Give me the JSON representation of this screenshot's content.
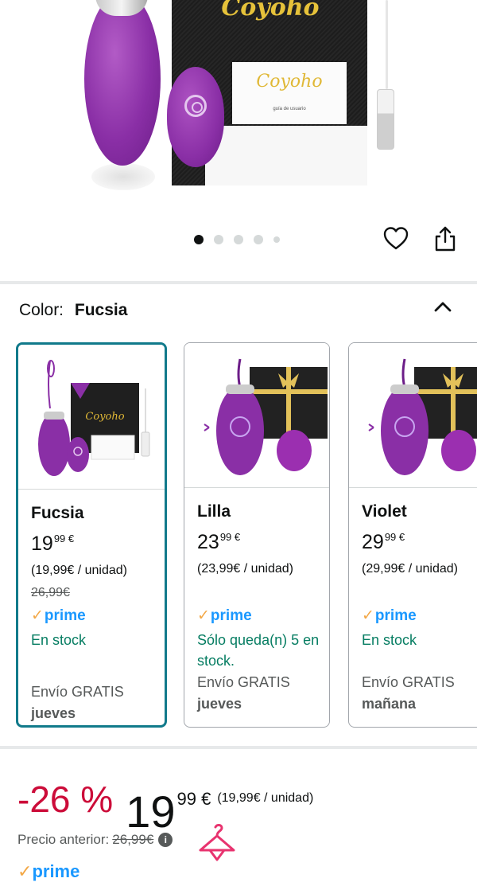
{
  "hero": {
    "brand": "Coyoho",
    "insert_brand": "Coyoho",
    "insert_subtitle": "guía de usuario",
    "dots_count": 5,
    "active_dot": 0
  },
  "color_selector": {
    "label": "Color:",
    "selected": "Fucsia"
  },
  "variants": [
    {
      "name": "Fucsia",
      "price_whole": "19",
      "price_fraction": "99",
      "currency": "€",
      "unit_price": "(19,99€ / unidad)",
      "old_price": "26,99€",
      "prime": "prime",
      "stock": "En stock",
      "shipping": "Envío GRATIS",
      "delivery_day": "jueves",
      "selected": true
    },
    {
      "name": "Lilla",
      "price_whole": "23",
      "price_fraction": "99",
      "currency": "€",
      "unit_price": "(23,99€ / unidad)",
      "old_price": "",
      "prime": "prime",
      "stock": "Sólo queda(n) 5 en stock.",
      "shipping": "Envío GRATIS",
      "delivery_day": "jueves",
      "selected": false
    },
    {
      "name": "Violet",
      "price_whole": "29",
      "price_fraction": "99",
      "currency": "€",
      "unit_price": "(29,99€ / unidad)",
      "old_price": "",
      "prime": "prime",
      "stock": "En stock",
      "shipping": "Envío GRATIS",
      "delivery_day": "mañana",
      "selected": false
    }
  ],
  "price": {
    "discount": "-26 %",
    "whole": "19",
    "fraction": "99",
    "currency": "€",
    "unit_price": "(19,99€ / unidad)",
    "previous_label": "Precio anterior:",
    "previous_value": "26,99€",
    "prime": "prime"
  },
  "colors": {
    "accent_teal": "#117a8b",
    "discount_red": "#cc0c39",
    "prime_blue": "#1a98ff",
    "prime_check": "#f3a847",
    "stock_green": "#067d62",
    "hanger_pink": "#e8336f"
  },
  "icons": [
    "heart-icon",
    "share-icon",
    "chevron-up-icon",
    "info-icon",
    "hanger-icon"
  ]
}
